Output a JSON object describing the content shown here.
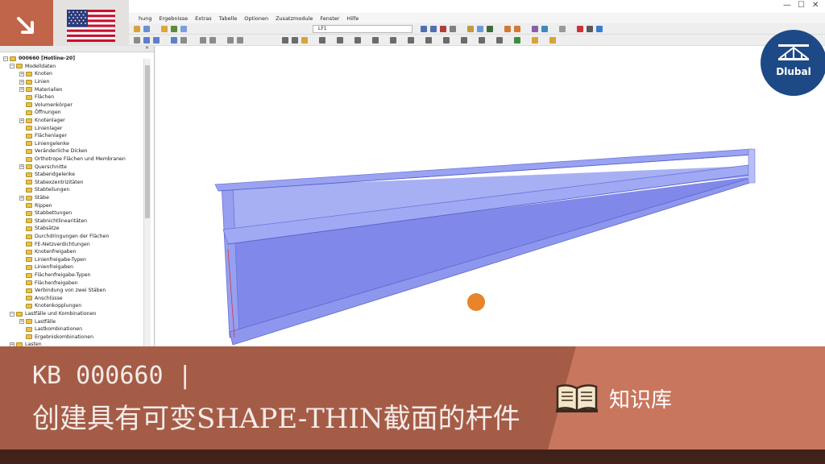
{
  "menu": [
    "hung",
    "Ergebnisse",
    "Extras",
    "Tabelle",
    "Optionen",
    "Zusatzmodule",
    "Fenster",
    "Hilfe"
  ],
  "window_controls": {
    "minimize": "—",
    "maximize": "☐",
    "close": "✕"
  },
  "toolbar": {
    "load_case_select": "LF1"
  },
  "navigator": {
    "close_glyph": "✕",
    "tree": [
      {
        "label": "000660 [Hotline-20]",
        "level": 0,
        "expander": "−",
        "root": true
      },
      {
        "label": "Modelldaten",
        "level": 1,
        "expander": "−"
      },
      {
        "label": "Knoten",
        "level": 2,
        "expander": "+"
      },
      {
        "label": "Linien",
        "level": 2,
        "expander": "+"
      },
      {
        "label": "Materialien",
        "level": 2,
        "expander": "+"
      },
      {
        "label": "Flächen",
        "level": 2,
        "expander": ""
      },
      {
        "label": "Volumenkörper",
        "level": 2,
        "expander": ""
      },
      {
        "label": "Öffnungen",
        "level": 2,
        "expander": ""
      },
      {
        "label": "Knotenlager",
        "level": 2,
        "expander": "+"
      },
      {
        "label": "Linienlager",
        "level": 2,
        "expander": ""
      },
      {
        "label": "Flächenlager",
        "level": 2,
        "expander": ""
      },
      {
        "label": "Liniengelenke",
        "level": 2,
        "expander": ""
      },
      {
        "label": "Veränderliche Dicken",
        "level": 2,
        "expander": ""
      },
      {
        "label": "Orthotrope Flächen und Membranen",
        "level": 2,
        "expander": ""
      },
      {
        "label": "Querschnitte",
        "level": 2,
        "expander": "+"
      },
      {
        "label": "Stabendgelenke",
        "level": 2,
        "expander": ""
      },
      {
        "label": "Stabexzentrizitäten",
        "level": 2,
        "expander": ""
      },
      {
        "label": "Stabteilungen",
        "level": 2,
        "expander": ""
      },
      {
        "label": "Stäbe",
        "level": 2,
        "expander": "+"
      },
      {
        "label": "Rippen",
        "level": 2,
        "expander": ""
      },
      {
        "label": "Stabbettungen",
        "level": 2,
        "expander": ""
      },
      {
        "label": "Stabnichtlinearitäten",
        "level": 2,
        "expander": ""
      },
      {
        "label": "Stabsätze",
        "level": 2,
        "expander": ""
      },
      {
        "label": "Durchdringungen der Flächen",
        "level": 2,
        "expander": ""
      },
      {
        "label": "FE-Netzverdichtungen",
        "level": 2,
        "expander": ""
      },
      {
        "label": "Knotenfreigaben",
        "level": 2,
        "expander": ""
      },
      {
        "label": "Linienfreigabe-Typen",
        "level": 2,
        "expander": ""
      },
      {
        "label": "Linienfreigaben",
        "level": 2,
        "expander": ""
      },
      {
        "label": "Flächenfreigabe-Typen",
        "level": 2,
        "expander": ""
      },
      {
        "label": "Flächenfreigaben",
        "level": 2,
        "expander": ""
      },
      {
        "label": "Verbindung von zwei Stäben",
        "level": 2,
        "expander": ""
      },
      {
        "label": "Anschlüsse",
        "level": 2,
        "expander": ""
      },
      {
        "label": "Knotenkopplungen",
        "level": 2,
        "expander": ""
      },
      {
        "label": "Lastfälle und Kombinationen",
        "level": 1,
        "expander": "−"
      },
      {
        "label": "Lastfälle",
        "level": 2,
        "expander": "+"
      },
      {
        "label": "Lastkombinationen",
        "level": 2,
        "expander": ""
      },
      {
        "label": "Ergebniskombinationen",
        "level": 2,
        "expander": ""
      },
      {
        "label": "Lasten",
        "level": 1,
        "expander": "+"
      }
    ]
  },
  "logo": {
    "text": "Dlubal"
  },
  "banner": {
    "kb_line": "KB 000660 |",
    "title": "创建具有可变SHAPE-THIN截面的杆件",
    "knowledge_base_label": "知识库"
  },
  "colors": {
    "banner_main": "#a55c47",
    "banner_accent": "#c9765e",
    "dlubal_blue": "#1d4a86",
    "beam_face": "#8a92ec"
  }
}
